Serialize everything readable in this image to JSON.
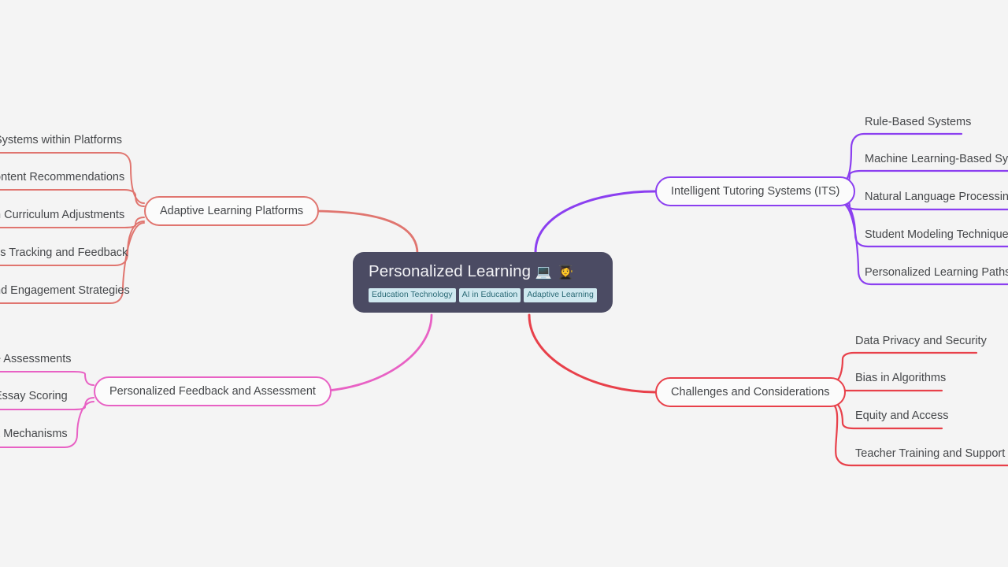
{
  "diagram": {
    "type": "mind-map",
    "background_color": "#f4f4f4",
    "root": {
      "title": "Personalized Learning",
      "emoji": "💻 👩‍🎓",
      "emoji_names": [
        "laptop-icon",
        "student-icon"
      ],
      "background_color": "#4b4b63",
      "text_color": "#f2f2f5",
      "tags": [
        {
          "label": "Education Technology"
        },
        {
          "label": "AI in Education"
        },
        {
          "label": "Adaptive Learning"
        }
      ],
      "tag_background_color": "#cfe8ef",
      "tag_text_color": "#2b6a76"
    },
    "branches": [
      {
        "id": "adaptive-learning-platforms",
        "label": "Adaptive Learning Platforms",
        "color": "#e0756f",
        "side": "left",
        "children": [
          {
            "label": "Systems within Platforms",
            "clipped": true
          },
          {
            "label": "ontent Recommendations",
            "clipped": true
          },
          {
            "label": "n Curriculum Adjustments",
            "clipped": true
          },
          {
            "label": "ss Tracking and Feedback",
            "clipped": true
          },
          {
            "label": "nd Engagement Strategies",
            "clipped": true
          }
        ]
      },
      {
        "id": "personalized-feedback-and-assessment",
        "label": "Personalized Feedback and Assessment",
        "color": "#e861c4",
        "side": "left",
        "children": [
          {
            "label": "e Assessments",
            "clipped": true
          },
          {
            "label": "Essay Scoring",
            "clipped": true
          },
          {
            "label": "k Mechanisms",
            "clipped": true
          }
        ]
      },
      {
        "id": "intelligent-tutoring-systems",
        "label": "Intelligent Tutoring Systems (ITS)",
        "color": "#8b3ff0",
        "side": "right",
        "children": [
          {
            "label": "Rule-Based Systems",
            "clipped": false
          },
          {
            "label": "Machine Learning-Based Syste",
            "clipped": true
          },
          {
            "label": "Natural Language Processing (",
            "clipped": true
          },
          {
            "label": "Student Modeling Techniques",
            "clipped": true
          },
          {
            "label": "Personalized Learning Paths a",
            "clipped": true
          }
        ]
      },
      {
        "id": "challenges-and-considerations",
        "label": "Challenges and Considerations",
        "color": "#e8404a",
        "side": "right",
        "children": [
          {
            "label": "Data Privacy and Security",
            "clipped": false
          },
          {
            "label": "Bias in Algorithms",
            "clipped": false
          },
          {
            "label": "Equity and Access",
            "clipped": false
          },
          {
            "label": "Teacher Training and Support",
            "clipped": false
          }
        ]
      }
    ]
  }
}
